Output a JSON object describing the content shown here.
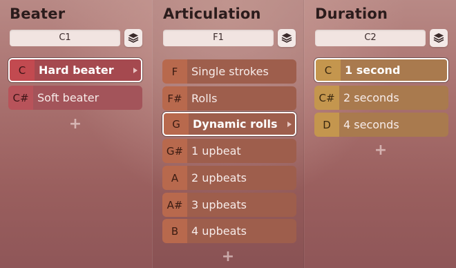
{
  "columns": [
    {
      "title": "Beater",
      "key_range": "C1",
      "items": [
        {
          "key": "C",
          "label": "Hard beater",
          "selected": true
        },
        {
          "key": "C#",
          "label": "Soft beater",
          "selected": false
        }
      ]
    },
    {
      "title": "Articulation",
      "key_range": "F1",
      "items": [
        {
          "key": "F",
          "label": "Single strokes",
          "selected": false
        },
        {
          "key": "F#",
          "label": "Rolls",
          "selected": false
        },
        {
          "key": "G",
          "label": "Dynamic rolls",
          "selected": true
        },
        {
          "key": "G#",
          "label": "1 upbeat",
          "selected": false
        },
        {
          "key": "A",
          "label": "2 upbeats",
          "selected": false
        },
        {
          "key": "A#",
          "label": "3 upbeats",
          "selected": false
        },
        {
          "key": "B",
          "label": "4 upbeats",
          "selected": false
        }
      ]
    },
    {
      "title": "Duration",
      "key_range": "C2",
      "items": [
        {
          "key": "C",
          "label": "1 second",
          "selected": true
        },
        {
          "key": "C#",
          "label": "2 seconds",
          "selected": false
        },
        {
          "key": "D",
          "label": "4 seconds",
          "selected": false
        }
      ]
    }
  ],
  "icons": {
    "layers": "layers-icon",
    "add": "plus-icon",
    "arrow": "triangle-right-icon"
  },
  "add_symbol": "+",
  "colors": {
    "beater_accent": "#c24a50",
    "articulation_accent": "#b8694d",
    "duration_accent": "#c4964e"
  }
}
